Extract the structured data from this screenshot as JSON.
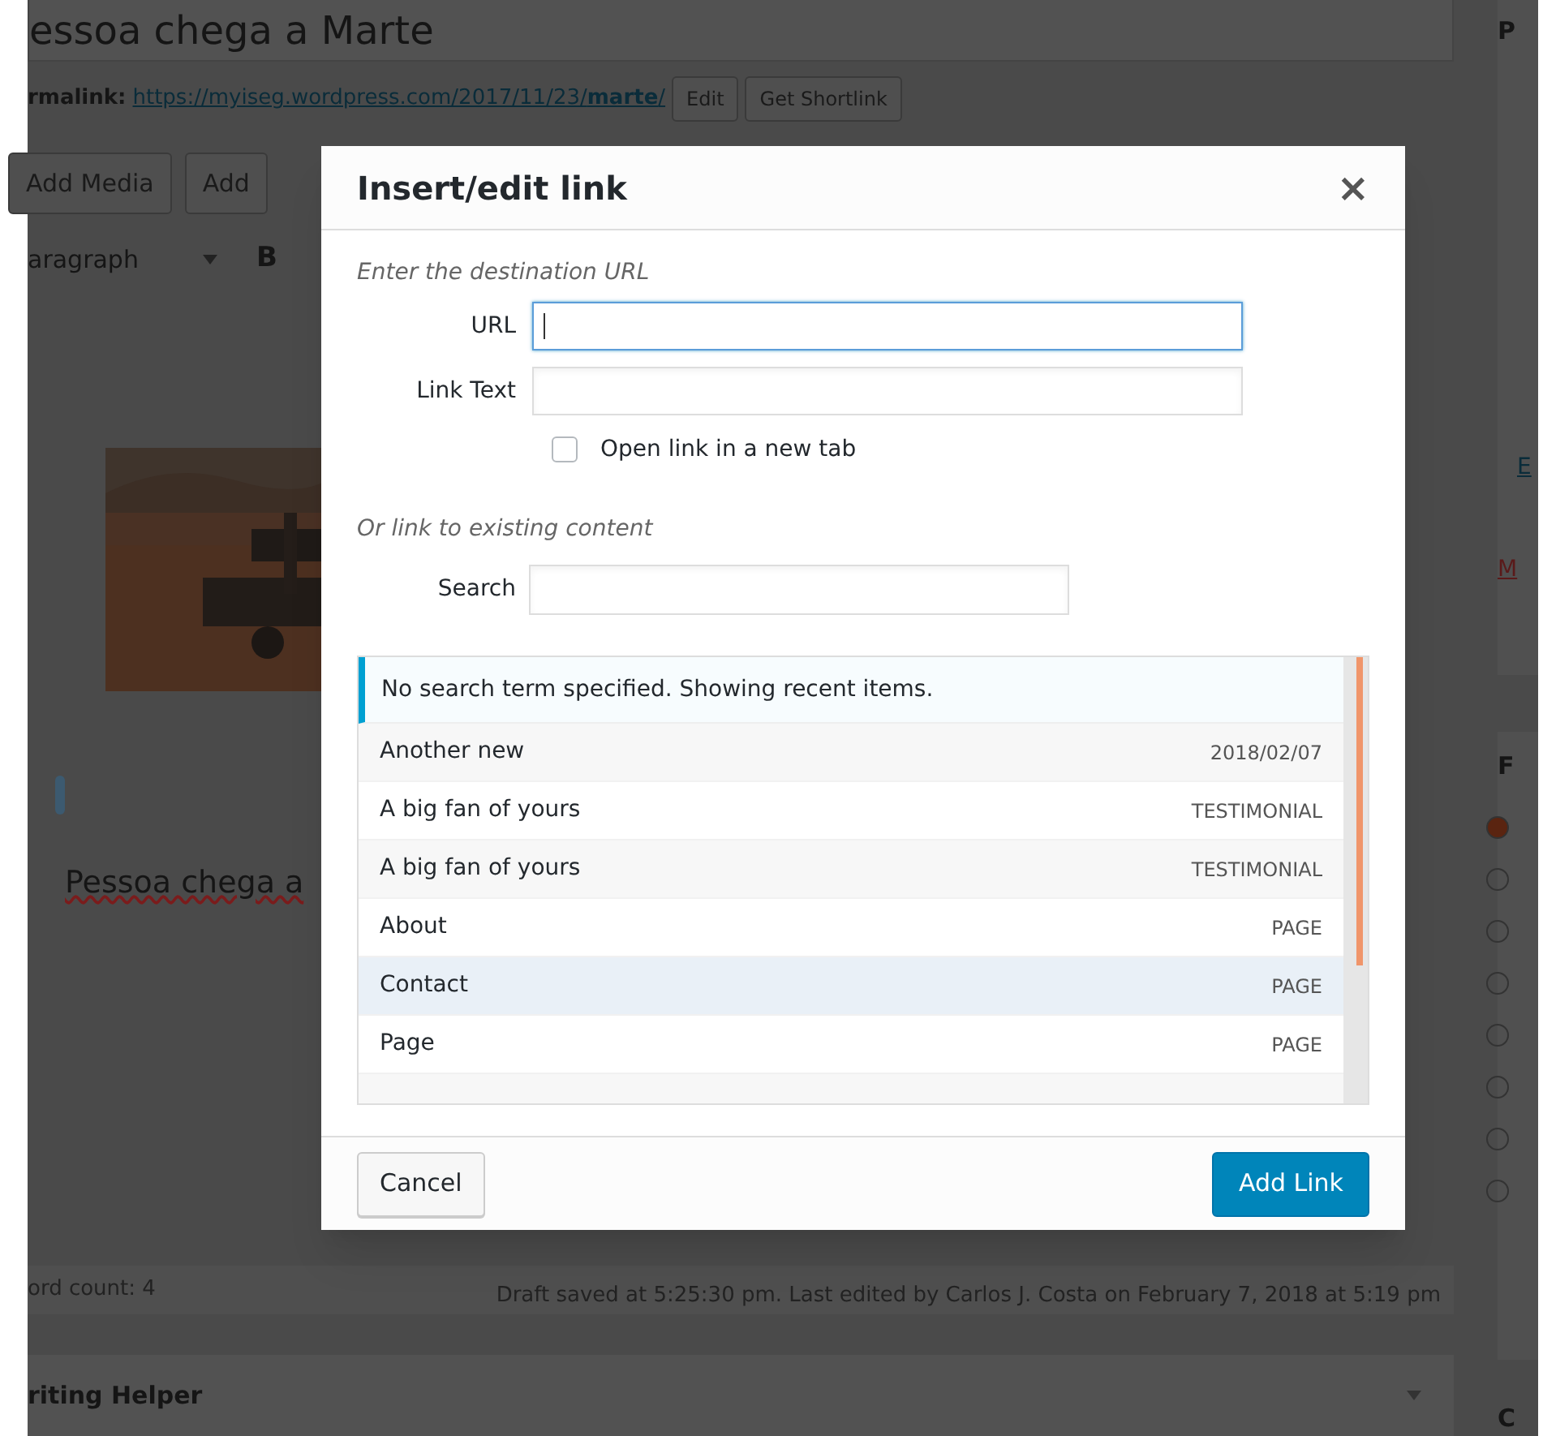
{
  "editor": {
    "title": "essoa chega a Marte",
    "permalink_label": "rmalink:",
    "permalink_url": "https://myiseg.wordpress.com/2017/11/23/**marte**/",
    "permalink_buttons": [
      "Edit",
      "Get Shortlink"
    ],
    "media_buttons": [
      "Add Media",
      "Add"
    ],
    "format_select": "aragraph",
    "bold_button": "B",
    "content_text": "Pessoa chega a",
    "word_count": "ord count: 4",
    "draft_status": "Draft saved at 5:25:30 pm. Last edited by Carlos J. Costa on February 7, 2018 at 5:19 pm",
    "helper_box": "riting Helper"
  },
  "sidebar": {
    "letters": [
      "P",
      "M",
      "F",
      "C"
    ],
    "link_letter": "E"
  },
  "dialog": {
    "title": "Insert/edit link",
    "close": "×",
    "url_hint": "Enter the destination URL",
    "url_label": "URL",
    "link_text_label": "Link Text",
    "new_tab": {
      "label": "Open link in a new tab",
      "checked": false
    },
    "existing_hint": "Or link to existing content",
    "search_label": "Search",
    "notice": "No search term specified. Showing recent items.",
    "results": [
      {
        "title": "Another new",
        "info": "2018/02/07",
        "selected": false
      },
      {
        "title": "A big fan of yours",
        "info": "TESTIMONIAL",
        "selected": false
      },
      {
        "title": "A big fan of yours",
        "info": "TESTIMONIAL",
        "selected": false
      },
      {
        "title": "About",
        "info": "PAGE",
        "selected": false
      },
      {
        "title": "Contact",
        "info": "PAGE",
        "selected": true
      },
      {
        "title": "Page",
        "info": "PAGE",
        "selected": false
      }
    ],
    "cancel": "Cancel",
    "submit": "Add Link"
  }
}
